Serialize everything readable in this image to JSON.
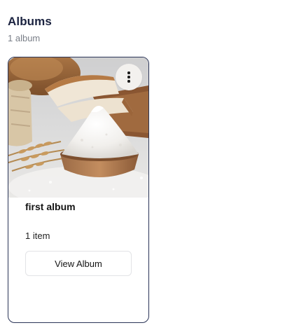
{
  "header": {
    "title": "Albums",
    "count_text": "1 album"
  },
  "albums": [
    {
      "name": "first album",
      "item_count_text": "1 item",
      "view_button_label": "View Album",
      "menu_icon": "more-vertical-icon",
      "cover_image": "bowl of flour with bread loaves and wheat stalks"
    }
  ],
  "colors": {
    "title": "#1b2340",
    "card_border": "#2a3457",
    "muted_text": "#7a7f88"
  }
}
